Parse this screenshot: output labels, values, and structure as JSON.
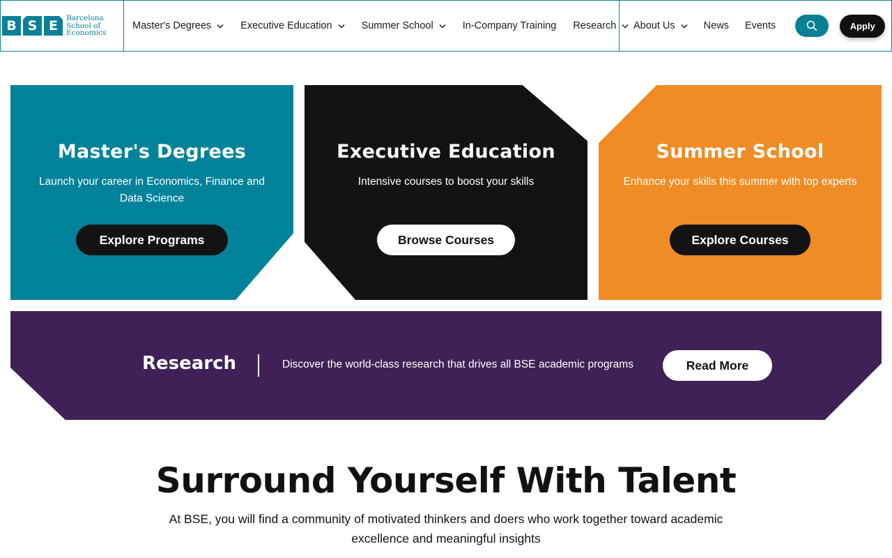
{
  "header": {
    "logo": {
      "letters": [
        "B",
        "S",
        "E"
      ],
      "lines": [
        "Barcelona",
        "School of",
        "Economics"
      ]
    },
    "nav_main": [
      {
        "label": "Master's Degrees",
        "has_dropdown": true
      },
      {
        "label": "Executive Education",
        "has_dropdown": true
      },
      {
        "label": "Summer School",
        "has_dropdown": true
      },
      {
        "label": "In-Company Training",
        "has_dropdown": false
      },
      {
        "label": "Research",
        "has_dropdown": true
      }
    ],
    "nav_secondary": [
      {
        "label": "About Us",
        "has_dropdown": true
      },
      {
        "label": "News",
        "has_dropdown": false
      },
      {
        "label": "Events",
        "has_dropdown": false
      }
    ],
    "search_icon": "search-icon",
    "apply_label": "Apply"
  },
  "cards": [
    {
      "title": "Master's Degrees",
      "subtitle": "Launch your career in Economics, Finance and Data Science",
      "button": "Explore Programs",
      "color": "#00829a"
    },
    {
      "title": "Executive Education",
      "subtitle": "Intensive courses to boost your skills",
      "button": "Browse Courses",
      "color": "#131313"
    },
    {
      "title": "Summer School",
      "subtitle": "Enhance your skills this summer with top experts",
      "button": "Explore Courses",
      "color": "#f08c24"
    }
  ],
  "research": {
    "title": "Research",
    "text": "Discover the world-class research that drives all BSE academic programs",
    "button": "Read More",
    "color": "#3f2157"
  },
  "talent": {
    "title": "Surround Yourself With Talent",
    "subtitle": "At BSE, you will find a community of motivated thinkers and doers who work together toward academic excellence and meaningful insights"
  },
  "colors": {
    "accent": "#0a8096",
    "dark": "#131313",
    "orange": "#f08c24",
    "purple": "#3f2157"
  }
}
